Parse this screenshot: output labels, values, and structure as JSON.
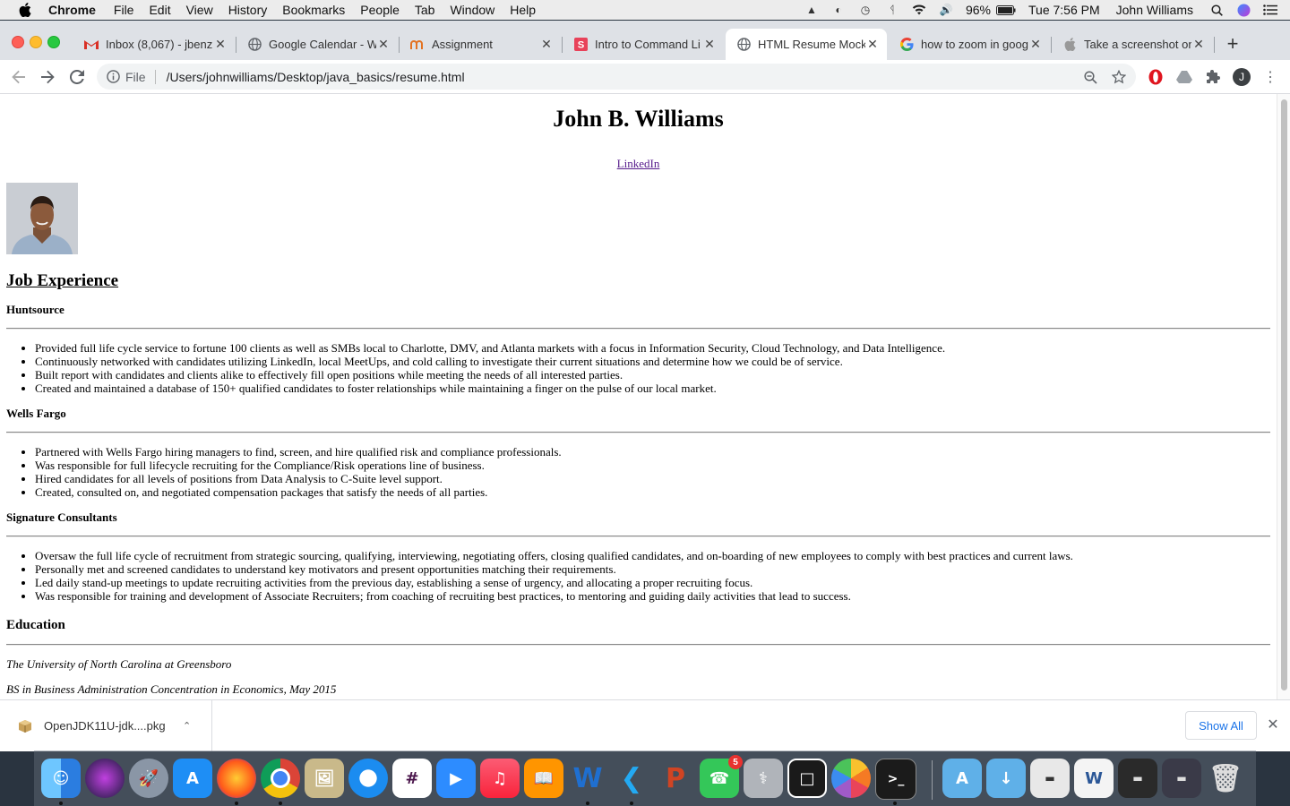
{
  "menubar": {
    "app": "Chrome",
    "items": [
      "File",
      "Edit",
      "View",
      "History",
      "Bookmarks",
      "People",
      "Tab",
      "Window",
      "Help"
    ],
    "battery": "96%",
    "clock": "Tue 7:56 PM",
    "user": "John Williams"
  },
  "tabs": [
    {
      "title": "Inbox (8,067) - jbenz",
      "icon": "gmail-icon"
    },
    {
      "title": "Google Calendar - W",
      "icon": "globe-icon"
    },
    {
      "title": "Assignment",
      "icon": "canvas-icon"
    },
    {
      "title": "Intro to Command Li",
      "icon": "s-icon"
    },
    {
      "title": "HTML Resume Mock",
      "icon": "globe-icon",
      "active": true
    },
    {
      "title": "how to zoom in goog",
      "icon": "google-icon"
    },
    {
      "title": "Take a screenshot on",
      "icon": "apple-icon"
    }
  ],
  "omnibox": {
    "scheme": "File",
    "path": "/Users/johnwilliams/Desktop/java_basics/resume.html"
  },
  "profile_initial": "J",
  "page": {
    "name": "John B. Williams",
    "linkedin": "LinkedIn",
    "job_heading": "Job Experience",
    "jobs": [
      {
        "company": "Huntsource",
        "bullets": [
          "Provided full life cycle service to fortune 100 clients as well as SMBs local to Charlotte, DMV, and Atlanta markets with a focus in Information Security, Cloud Technology, and Data Intelligence.",
          "Continuously networked with candidates utilizing LinkedIn, local MeetUps, and cold calling to investigate their current situations and determine how we could be of service.",
          "Built report with candidates and clients alike to effectively fill open positions while meeting the needs of all interested parties.",
          "Created and maintained a database of 150+ qualified candidates to foster relationships while maintaining a finger on the pulse of our local market."
        ]
      },
      {
        "company": "Wells Fargo",
        "bullets": [
          "Partnered with Wells Fargo hiring managers to find, screen, and hire qualified risk and compliance professionals.",
          "Was responsible for full lifecycle recruiting for the Compliance/Risk operations line of business.",
          "Hired candidates for all levels of positions from Data Analysis to C-Suite level support.",
          "Created, consulted on, and negotiated compensation packages that satisfy the needs of all parties."
        ]
      },
      {
        "company": "Signature Consultants",
        "bullets": [
          "Oversaw the full life cycle of recruitment from strategic sourcing, qualifying, interviewing, negotiating offers, closing qualified candidates, and on-boarding of new employees to comply with best practices and current laws.",
          "Personally met and screened candidates to understand key motivators and present opportunities matching their requirements.",
          "Led daily stand-up meetings to update recruiting activities from the previous day, establishing a sense of urgency, and allocating a proper recruiting focus.",
          "Was responsible for training and development of Associate Recruiters; from coaching of recruiting best practices, to mentoring and guiding daily activities that lead to success."
        ]
      }
    ],
    "education_heading": "Education",
    "school": "The University of North Carolina at Greensboro",
    "degree": "BS in Business Administration Concentration in Economics, May 2015"
  },
  "downloads": {
    "file": "OpenJDK11U-jdk....pkg",
    "show_all": "Show All"
  },
  "dock": {
    "facetime_badge": "5"
  },
  "colors": {
    "tab_strip": "#dee1e6",
    "link_visited": "#551a8b",
    "show_all_blue": "#1a73e8"
  }
}
